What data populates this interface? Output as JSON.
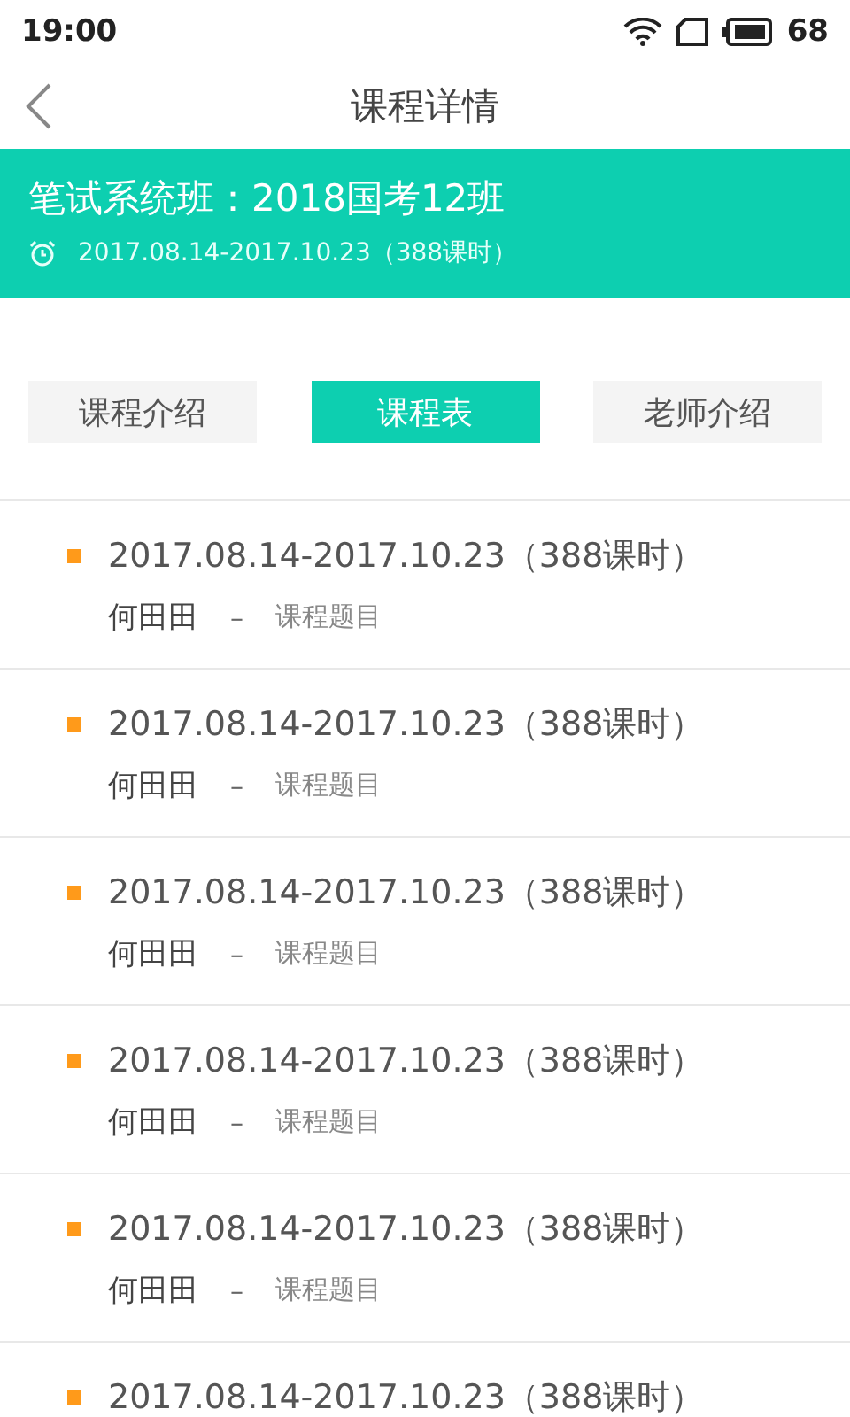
{
  "status_bar": {
    "time": "19:00",
    "battery": "68"
  },
  "nav": {
    "title": "课程详情"
  },
  "banner": {
    "title": "笔试系统班：2018国考12班",
    "period": "2017.08.14-2017.10.23（388课时）"
  },
  "tabs": [
    {
      "label": "课程介绍",
      "selected": false
    },
    {
      "label": "课程表",
      "selected": true
    },
    {
      "label": "老师介绍",
      "selected": false
    }
  ],
  "schedule": [
    {
      "period": "2017.08.14-2017.10.23（388课时）",
      "teacher": "何田田",
      "separator": "–",
      "topic": "课程题目"
    },
    {
      "period": "2017.08.14-2017.10.23（388课时）",
      "teacher": "何田田",
      "separator": "–",
      "topic": "课程题目"
    },
    {
      "period": "2017.08.14-2017.10.23（388课时）",
      "teacher": "何田田",
      "separator": "–",
      "topic": "课程题目"
    },
    {
      "period": "2017.08.14-2017.10.23（388课时）",
      "teacher": "何田田",
      "separator": "–",
      "topic": "课程题目"
    },
    {
      "period": "2017.08.14-2017.10.23（388课时）",
      "teacher": "何田田",
      "separator": "–",
      "topic": "课程题目"
    },
    {
      "period": "2017.08.14-2017.10.23（388课时）"
    }
  ]
}
